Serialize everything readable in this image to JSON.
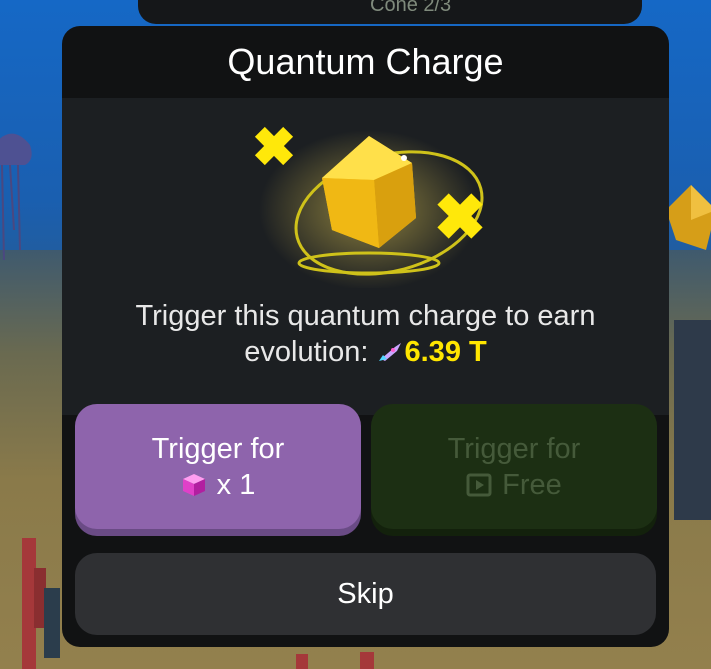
{
  "dialog": {
    "title": "Quantum Charge",
    "description_line1": "Trigger this quantum charge to earn",
    "description_prefix": "evolution:",
    "reward_value": "6.39 T",
    "reward_color": "#ffe600"
  },
  "buttons": {
    "gem": {
      "label_line1": "Trigger for",
      "cost": "x 1",
      "icon": "pink-cube-icon",
      "color": "#8e64ac"
    },
    "free": {
      "label_line1": "Trigger for",
      "label_line2": "Free",
      "icon": "play-video-icon",
      "color": "#1c2f13"
    },
    "skip": {
      "label": "Skip",
      "color": "#2f3033"
    }
  },
  "top_strip": {
    "text": "Cone 2/3"
  },
  "icons": {
    "reward": "rocket-icon",
    "art": "golden-gem-with-sparkles"
  }
}
